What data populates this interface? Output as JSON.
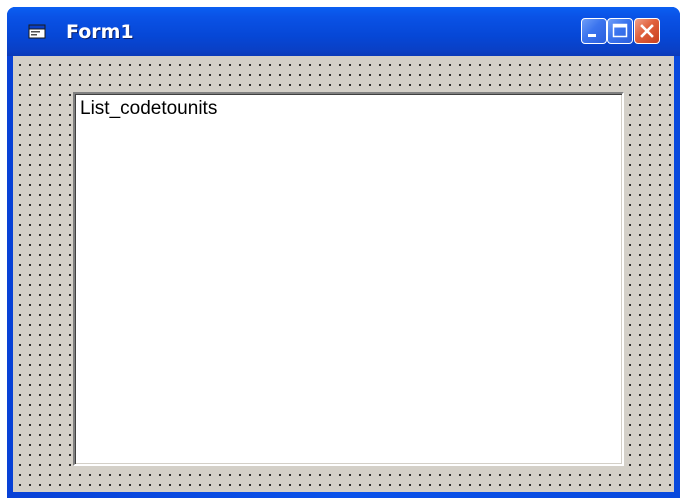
{
  "window": {
    "title": "Form1"
  },
  "titlebar": {
    "icon": "form-icon",
    "buttons": [
      "minimize-icon",
      "maximize-icon",
      "close-icon"
    ]
  },
  "listbox": {
    "label": "List_codetounits"
  },
  "colors": {
    "titlebar_blue": "#0a52e6",
    "client_gray": "#d4d0c8",
    "close_red": "#e0603c"
  }
}
